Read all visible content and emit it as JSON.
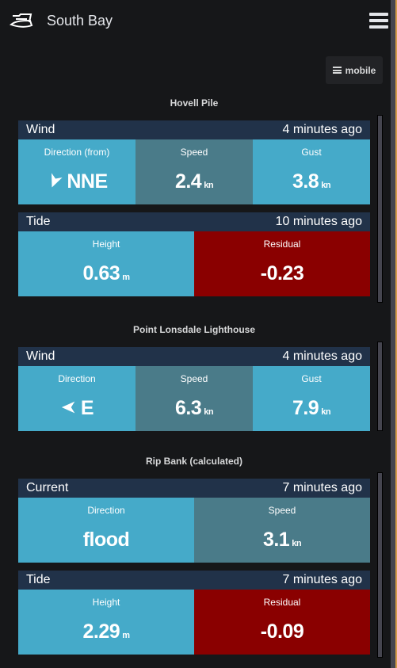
{
  "app": {
    "title": "South Bay",
    "logo_icon": "boat-logo-icon",
    "menu_icon": "hamburger-menu-icon"
  },
  "toolbar": {
    "mobile_label": "mobile"
  },
  "colors": {
    "background": "#161719",
    "panel_header": "#213249",
    "cell_blue": "#45aac9",
    "cell_slate": "#4a7b89",
    "cell_red": "#8a0000"
  },
  "sections": [
    {
      "title": "Hovell Pile",
      "panels": [
        {
          "title": "Wind",
          "updated": "4 minutes ago",
          "cells": [
            {
              "label": "Direction (from)",
              "value": "NNE",
              "unit": "",
              "icon": "wind-direction-arrow-icon",
              "direction_deg": 22.5
            },
            {
              "label": "Speed",
              "value": "2.4",
              "unit": "kn"
            },
            {
              "label": "Gust",
              "value": "3.8",
              "unit": "kn"
            }
          ]
        },
        {
          "title": "Tide",
          "updated": "10 minutes ago",
          "cells": [
            {
              "label": "Height",
              "value": "0.63",
              "unit": "m"
            },
            {
              "label": "Residual",
              "value": "-0.23",
              "unit": ""
            }
          ]
        }
      ]
    },
    {
      "title": "Point Lonsdale Lighthouse",
      "panels": [
        {
          "title": "Wind",
          "updated": "4 minutes ago",
          "cells": [
            {
              "label": "Direction",
              "value": "E",
              "unit": "",
              "icon": "wind-direction-arrow-icon",
              "direction_deg": 90
            },
            {
              "label": "Speed",
              "value": "6.3",
              "unit": "kn"
            },
            {
              "label": "Gust",
              "value": "7.9",
              "unit": "kn"
            }
          ]
        }
      ]
    },
    {
      "title": "Rip Bank (calculated)",
      "panels": [
        {
          "title": "Current",
          "updated": "7 minutes ago",
          "cells": [
            {
              "label": "Direction",
              "value": "flood",
              "unit": ""
            },
            {
              "label": "Speed",
              "value": "3.1",
              "unit": "kn"
            }
          ]
        },
        {
          "title": "Tide",
          "updated": "7 minutes ago",
          "cells": [
            {
              "label": "Height",
              "value": "2.29",
              "unit": "m"
            },
            {
              "label": "Residual",
              "value": "-0.09",
              "unit": ""
            }
          ]
        }
      ]
    }
  ]
}
